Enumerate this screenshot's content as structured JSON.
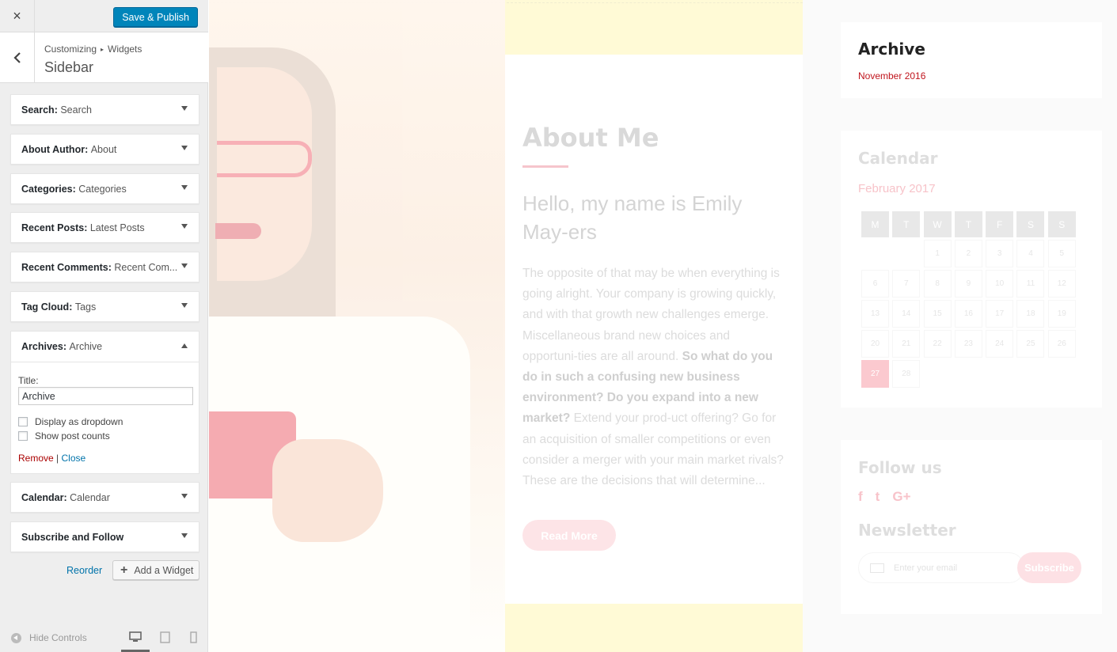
{
  "customizer": {
    "close_icon": "×",
    "publish_label": "Save & Publish",
    "breadcrumb": {
      "root": "Customizing",
      "separator": "▸",
      "current": "Widgets"
    },
    "section_title": "Sidebar",
    "widgets": [
      {
        "type": "Search",
        "title": "Search"
      },
      {
        "type": "About Author",
        "title": "About"
      },
      {
        "type": "Categories",
        "title": "Categories"
      },
      {
        "type": "Recent Posts",
        "title": "Latest Posts"
      },
      {
        "type": "Recent Comments",
        "title": "Recent Com..."
      },
      {
        "type": "Tag Cloud",
        "title": "Tags"
      }
    ],
    "expanded_widget": {
      "type": "Archives",
      "title": "Archive",
      "title_label": "Title:",
      "title_value": "Archive",
      "option_dropdown": "Display as dropdown",
      "option_counts": "Show post counts",
      "remove_label": "Remove",
      "divider": "|",
      "close_label": "Close"
    },
    "widgets_after": [
      {
        "type": "Calendar",
        "title": "Calendar"
      },
      {
        "type": "Subscribe and Follow",
        "title": ""
      }
    ],
    "reorder_label": "Reorder",
    "add_widget_label": "Add a Widget",
    "hide_controls_label": "Hide Controls"
  },
  "preview": {
    "about": {
      "title": "About Me",
      "hello": "Hello, my name is Emily May-ers",
      "body_start": "The opposite of that may be when everything is going alright. Your company is growing quickly, and with that growth new challenges emerge. Miscellaneous brand new choices and opportuni-ties are all around. ",
      "body_bold": "So what do you do in such a confusing new business environment? Do you expand into a new market?",
      "body_end": " Extend your prod-uct offering? Go for an acquisition of smaller competitions or even consider a merger with your main market rivals? These are the decisions that will determine...",
      "read_more": "Read More"
    },
    "sidebar": {
      "archive_heading": "Archive",
      "archive_link": "November 2016",
      "calendar_heading": "Calendar",
      "calendar_month": "February 2017",
      "weekdays": [
        "M",
        "T",
        "W",
        "T",
        "F",
        "S",
        "S"
      ],
      "leading_blanks": 2,
      "days_in_month": 28,
      "today": 27,
      "follow_heading": "Follow us",
      "social": [
        "f",
        "t",
        "G+"
      ],
      "newsletter_heading": "Newsletter",
      "email_placeholder": "Enter your email",
      "subscribe_label": "Subscribe"
    }
  },
  "colors": {
    "publish": "#0085ba",
    "link": "#0073aa",
    "remove": "#a00",
    "archive_link": "#c0151d"
  }
}
